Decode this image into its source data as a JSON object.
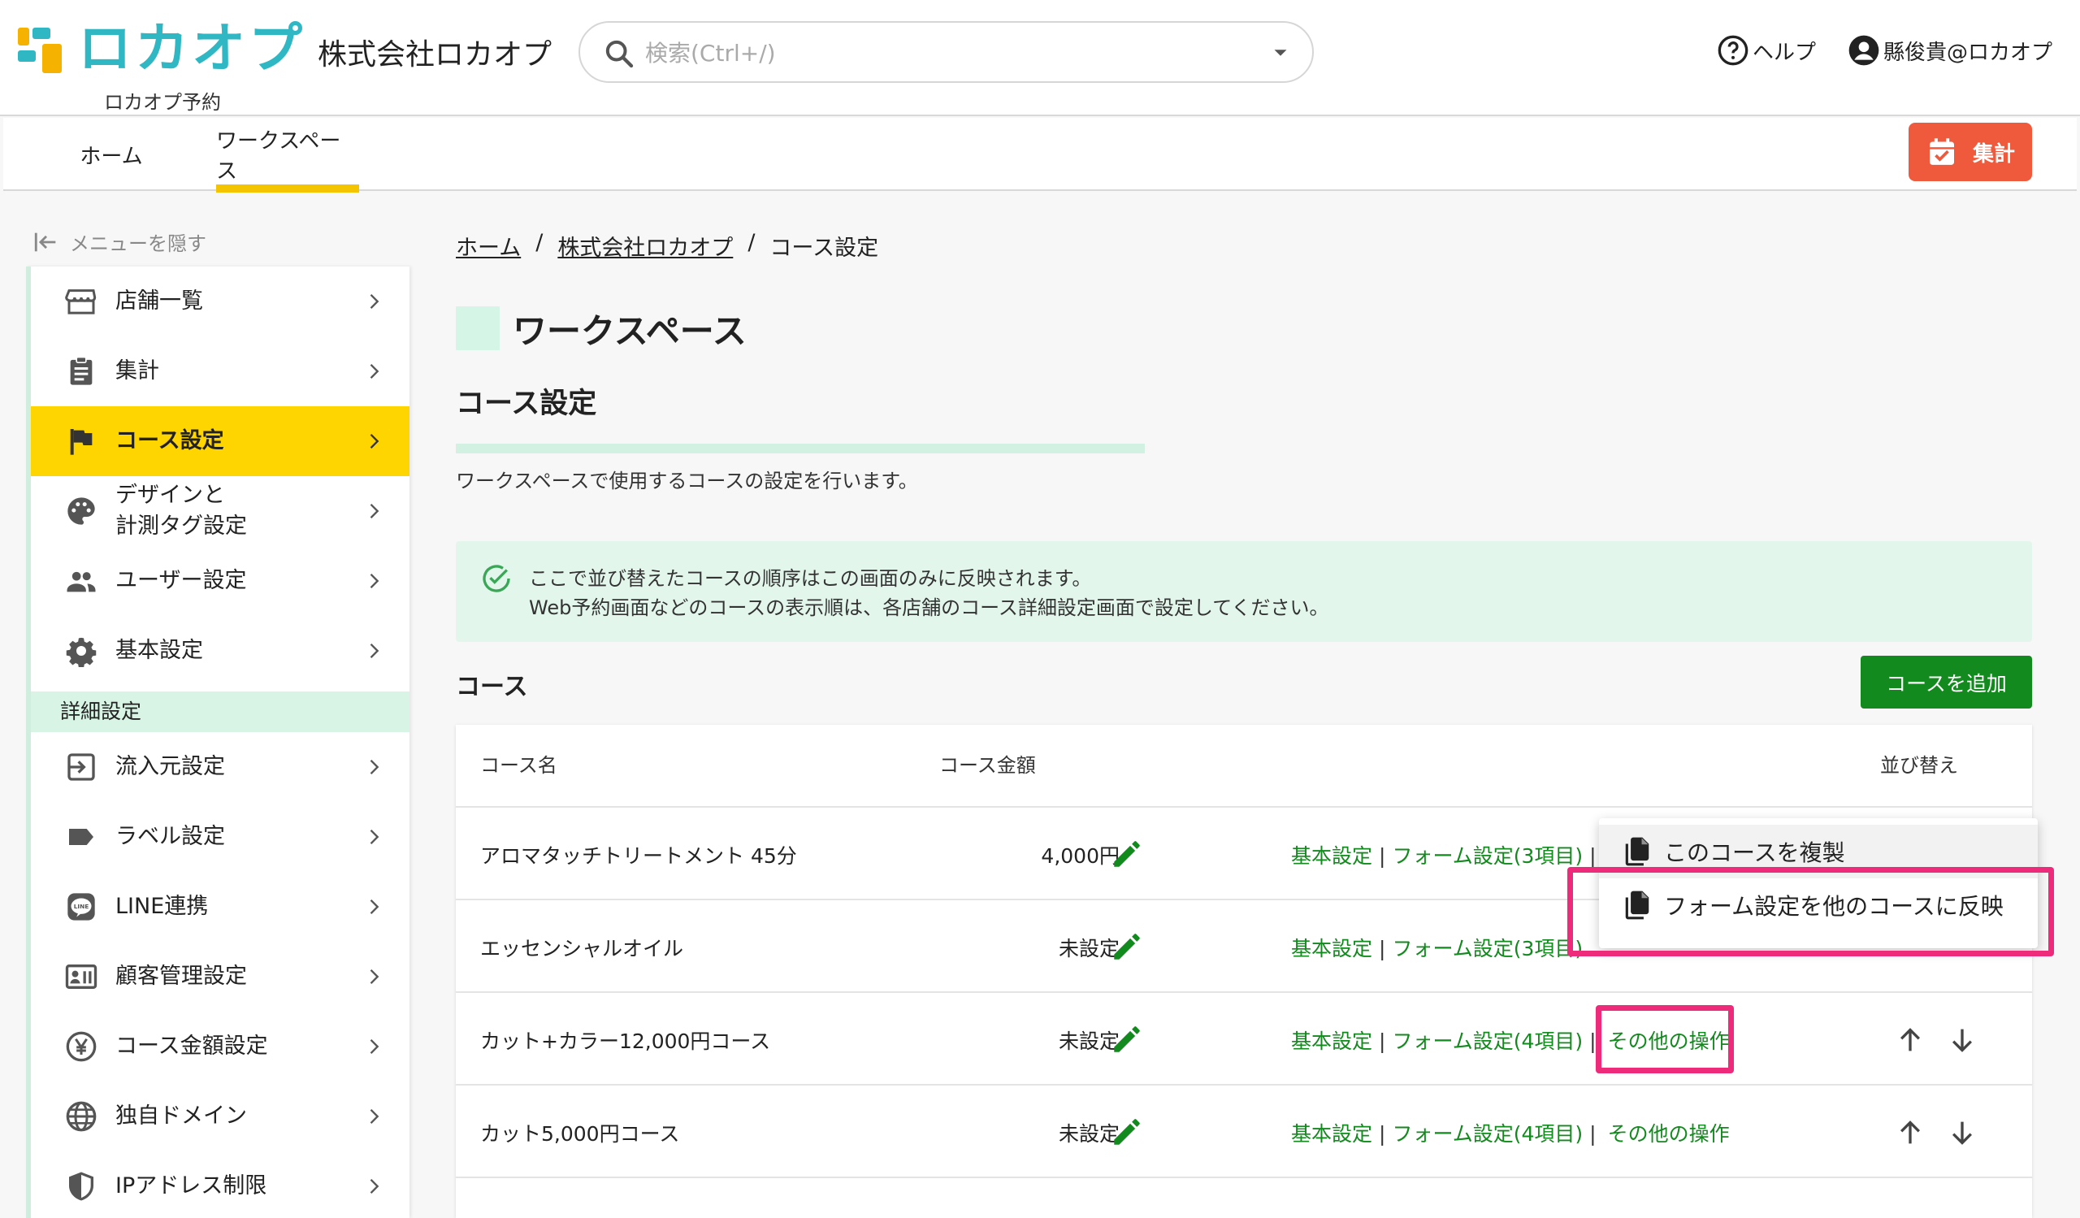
{
  "header": {
    "logo_text": "ロカオプ",
    "logo_subtitle": "ロカオプ予約",
    "company_name": "株式会社ロカオプ",
    "search_placeholder": "検索(Ctrl+/)",
    "help_label": "ヘルプ",
    "user_label": "縣俊貴@ロカオプ"
  },
  "tabs": [
    {
      "label": "ホーム",
      "active": false
    },
    {
      "label": "ワークスペース",
      "active": true
    }
  ],
  "shukei_button": "集計",
  "sidebar": {
    "hide_label": "メニューを隠す",
    "items": [
      {
        "label": "店舗一覧",
        "icon": "store-icon"
      },
      {
        "label": "集計",
        "icon": "clipboard-icon"
      },
      {
        "label": "コース設定",
        "icon": "flag-icon",
        "active": true
      },
      {
        "label": "デザインと\n計測タグ設定",
        "icon": "palette-icon"
      },
      {
        "label": "ユーザー設定",
        "icon": "people-icon"
      },
      {
        "label": "基本設定",
        "icon": "gear-icon"
      }
    ],
    "section_label": "詳細設定",
    "detail_items": [
      {
        "label": "流入元設定",
        "icon": "login-icon"
      },
      {
        "label": "ラベル設定",
        "icon": "label-icon"
      },
      {
        "label": "LINE連携",
        "icon": "line-icon"
      },
      {
        "label": "顧客管理設定",
        "icon": "contact-card-icon"
      },
      {
        "label": "コース金額設定",
        "icon": "yen-icon"
      },
      {
        "label": "独自ドメイン",
        "icon": "globe-icon"
      },
      {
        "label": "IPアドレス制限",
        "icon": "shield-icon"
      }
    ]
  },
  "breadcrumb": {
    "home": "ホーム",
    "company": "株式会社ロカオプ",
    "current": "コース設定",
    "separator": "/"
  },
  "workspace_title": "ワークスペース",
  "page_title": "コース設定",
  "description": "ワークスペースで使用するコースの設定を行います。",
  "notice": {
    "line1": "ここで並び替えたコースの順序はこの画面のみに反映されます。",
    "line2": "Web予約画面などのコースの表示順は、各店舗のコース詳細設定画面で設定してください。"
  },
  "courses_section": {
    "title": "コース",
    "add_button": "コースを追加",
    "headers": {
      "name": "コース名",
      "price": "コース金額",
      "sort": "並び替え"
    },
    "rows": [
      {
        "name": "アロマタッチトリートメント 45分",
        "price": "4,000円",
        "basic": "基本設定",
        "form": "フォーム設定(3項目)",
        "other": ""
      },
      {
        "name": "エッセンシャルオイル",
        "price": "未設定",
        "basic": "基本設定",
        "form": "フォーム設定(3項目)",
        "other": ""
      },
      {
        "name": "カット+カラー12,000円コース",
        "price": "未設定",
        "basic": "基本設定",
        "form": "フォーム設定(4項目)",
        "other": "その他の操作"
      },
      {
        "name": "カット5,000円コース",
        "price": "未設定",
        "basic": "基本設定",
        "form": "フォーム設定(4項目)",
        "other": "その他の操作"
      }
    ]
  },
  "context_menu": {
    "items": [
      "このコースを複製",
      "フォーム設定を他のコースに反映"
    ]
  },
  "colors": {
    "brand_teal": "#2fb7c4",
    "accent_yellow": "#ffd500",
    "action_green": "#138a1e",
    "shukei_orange": "#f05a3c",
    "highlight_pink": "#ee2a7b"
  }
}
